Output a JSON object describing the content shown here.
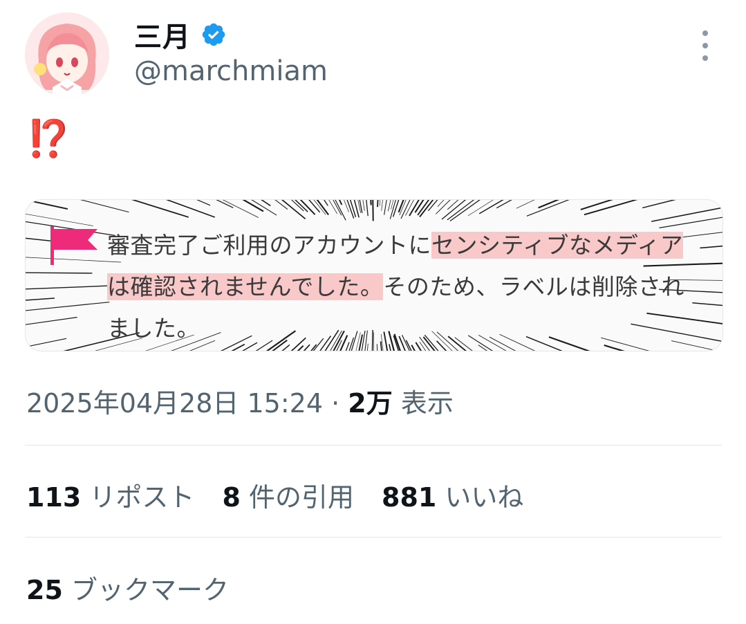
{
  "user": {
    "display_name": "三月",
    "handle": "@marchmiam",
    "verified": true
  },
  "tweet": {
    "text": "⁉️"
  },
  "media": {
    "text_plain_1": "審査完了ご利用のアカウントに",
    "text_highlight": "センシティブなメディアは確認されませんでした。",
    "text_plain_2": "そのため、ラベルは削除されました。",
    "accent_color": "#ee2a7b",
    "highlight_color": "#f9c9c9"
  },
  "meta": {
    "timestamp": "2025年04月28日 15:24",
    "separator": "·",
    "views_count": "2万",
    "views_label": "表示"
  },
  "stats": {
    "reposts_count": "113",
    "reposts_label": "リポスト",
    "quotes_count": "8",
    "quotes_label": "件の引用",
    "likes_count": "881",
    "likes_label": "いいね",
    "bookmarks_count": "25",
    "bookmarks_label": "ブックマーク"
  },
  "colors": {
    "verified_blue": "#1d9bf0",
    "secondary_text": "#536471",
    "primary_text": "#0f1419"
  }
}
